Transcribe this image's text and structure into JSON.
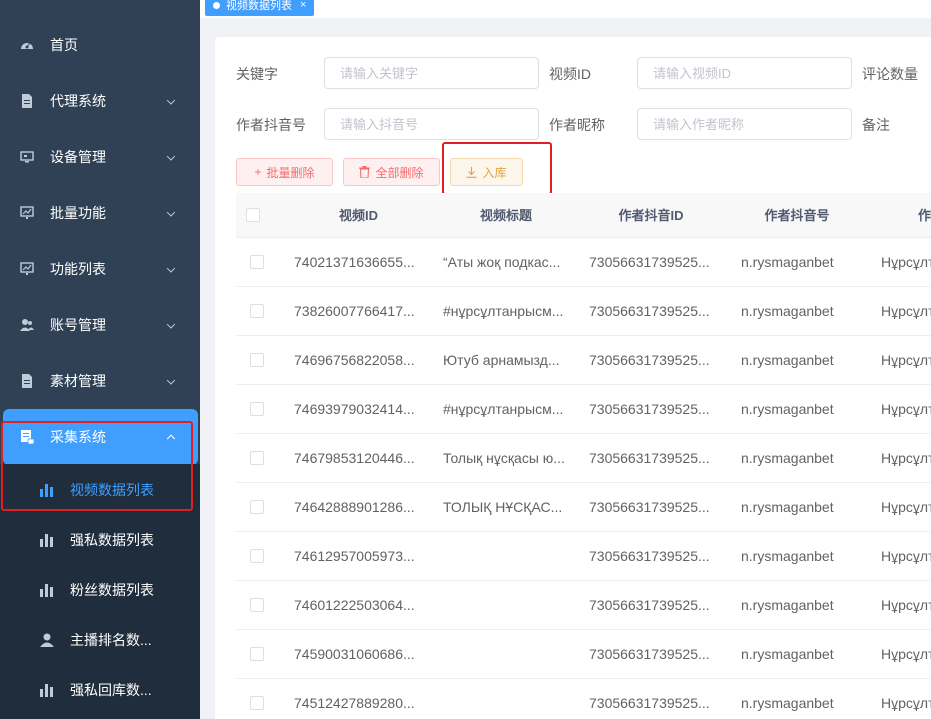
{
  "sidebar": {
    "items": [
      {
        "label": "首页",
        "icon": "dashboard-icon",
        "has_children": false
      },
      {
        "label": "代理系统",
        "icon": "document-icon",
        "has_children": true
      },
      {
        "label": "设备管理",
        "icon": "monitor-icon",
        "has_children": true
      },
      {
        "label": "批量功能",
        "icon": "chart-screen-icon",
        "has_children": true
      },
      {
        "label": "功能列表",
        "icon": "chart-screen-icon",
        "has_children": true
      },
      {
        "label": "账号管理",
        "icon": "users-icon",
        "has_children": true
      },
      {
        "label": "素材管理",
        "icon": "document-icon",
        "has_children": true
      },
      {
        "label": "采集系统",
        "icon": "collect-icon",
        "has_children": true,
        "open": true
      }
    ],
    "sub_items": [
      {
        "label": "视频数据列表",
        "icon": "bar-chart-icon",
        "active": true
      },
      {
        "label": "强私数据列表",
        "icon": "bar-chart-icon"
      },
      {
        "label": "粉丝数据列表",
        "icon": "bar-chart-icon"
      },
      {
        "label": "主播排名数...",
        "icon": "user-icon"
      },
      {
        "label": "强私回库数...",
        "icon": "bar-chart-icon"
      }
    ],
    "active_color": "#409eff",
    "background": "#304156"
  },
  "tagbar": {
    "tag_label": "视频数据列表",
    "close_symbol": "×"
  },
  "search_form": {
    "keyword_label": "关键字",
    "keyword_placeholder": "请输入关键字",
    "video_id_label": "视频ID",
    "video_id_placeholder": "请输入视频ID",
    "comment_count_label": "评论数量",
    "author_douyin_label": "作者抖音号",
    "author_douyin_placeholder": "请输入抖音号",
    "author_nickname_label": "作者昵称",
    "author_nickname_placeholder": "请输入作者昵称",
    "remark_label": "备注"
  },
  "toolbar": {
    "batch_delete_label": "批量删除",
    "delete_all_label": "全部删除",
    "import_label": "入库"
  },
  "table": {
    "columns": [
      "视频ID",
      "视频标题",
      "作者抖音ID",
      "作者抖音号",
      "作"
    ],
    "rows": [
      {
        "video_id": "74021371636655...",
        "title": "“Аты жоқ подкас...",
        "author_id": "73056631739525...",
        "douyin": "n.rysmaganbet",
        "nickname": "Нұрсұлт"
      },
      {
        "video_id": "73826007766417...",
        "title": "#нұрсұлтанрысм...",
        "author_id": "73056631739525...",
        "douyin": "n.rysmaganbet",
        "nickname": "Нұрсұлт"
      },
      {
        "video_id": "74696756822058...",
        "title": "Ютуб арнамызд...",
        "author_id": "73056631739525...",
        "douyin": "n.rysmaganbet",
        "nickname": "Нұрсұлт"
      },
      {
        "video_id": "74693979032414...",
        "title": "#нұрсұлтанрысм...",
        "author_id": "73056631739525...",
        "douyin": "n.rysmaganbet",
        "nickname": "Нұрсұлт"
      },
      {
        "video_id": "74679853120446...",
        "title": "Толық нұсқасы ю...",
        "author_id": "73056631739525...",
        "douyin": "n.rysmaganbet",
        "nickname": "Нұрсұлт"
      },
      {
        "video_id": "74642888901286...",
        "title": "ТОЛЫҚ НҰСҚАС...",
        "author_id": "73056631739525...",
        "douyin": "n.rysmaganbet",
        "nickname": "Нұрсұлт"
      },
      {
        "video_id": "74612957005973...",
        "title": "",
        "author_id": "73056631739525...",
        "douyin": "n.rysmaganbet",
        "nickname": "Нұрсұлт"
      },
      {
        "video_id": "74601222503064...",
        "title": "",
        "author_id": "73056631739525...",
        "douyin": "n.rysmaganbet",
        "nickname": "Нұрсұлт"
      },
      {
        "video_id": "74590031060686...",
        "title": "",
        "author_id": "73056631739525...",
        "douyin": "n.rysmaganbet",
        "nickname": "Нұрсұлт"
      },
      {
        "video_id": "74512427889280...",
        "title": "",
        "author_id": "73056631739525...",
        "douyin": "n.rysmaganbet",
        "nickname": "Нұрсұлт"
      }
    ]
  }
}
